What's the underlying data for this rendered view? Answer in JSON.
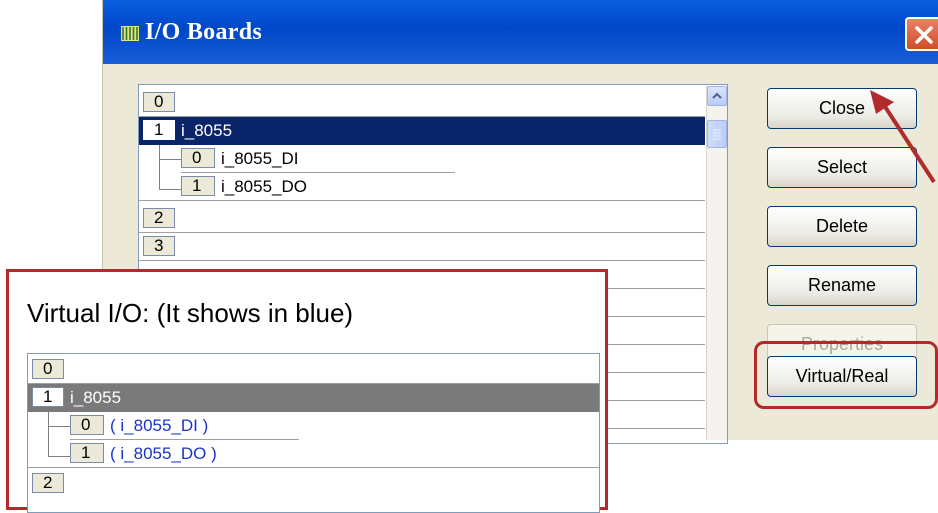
{
  "window": {
    "title": "I/O Boards",
    "close_icon": "close-x-icon"
  },
  "slots": [
    {
      "num": "0",
      "name": ""
    },
    {
      "num": "1",
      "name": "i_8055",
      "selected": true
    },
    {
      "num": "0",
      "name": "i_8055_DI",
      "sub": true
    },
    {
      "num": "1",
      "name": "i_8055_DO",
      "sub": true
    },
    {
      "num": "2",
      "name": ""
    },
    {
      "num": "3",
      "name": ""
    }
  ],
  "buttons": {
    "close": "Close",
    "select": "Select",
    "delete": "Delete",
    "rename": "Rename",
    "properties": "Properties",
    "virtual_real": "Virtual/Real"
  },
  "callout": {
    "caption": "Virtual I/O:  (It shows in blue)",
    "rows": [
      {
        "num": "0",
        "name": ""
      },
      {
        "num": "1",
        "name": "i_8055"
      },
      {
        "num": "0",
        "name": "( i_8055_DI )"
      },
      {
        "num": "1",
        "name": "( i_8055_DO )"
      },
      {
        "num": "2",
        "name": ""
      }
    ]
  },
  "colors": {
    "selection": "#0a246a",
    "virtual_text": "#1a33cc",
    "highlight": "#b22a2a",
    "title_bar": "#0047c8"
  }
}
